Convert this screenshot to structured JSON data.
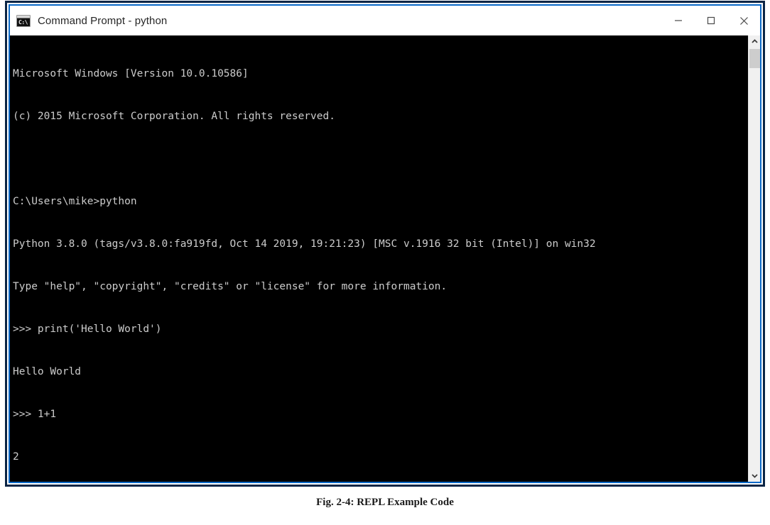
{
  "window": {
    "title": "Command Prompt - python",
    "icon": "console-icon",
    "icon_glyph": "C:\\",
    "border_color": "#0b2545",
    "accent_color": "#0a69c8",
    "controls": [
      {
        "name": "minimize-button",
        "label": "Minimize",
        "glyph": "minimize-icon"
      },
      {
        "name": "maximize-button",
        "label": "Maximize",
        "glyph": "maximize-icon"
      },
      {
        "name": "close-button",
        "label": "Close",
        "glyph": "close-icon"
      }
    ]
  },
  "console": {
    "background_color": "#000000",
    "text_color": "#cccccc",
    "cursor": "block-cursor",
    "lines": [
      "Microsoft Windows [Version 10.0.10586]",
      "(c) 2015 Microsoft Corporation. All rights reserved.",
      "",
      "C:\\Users\\mike>python",
      "Python 3.8.0 (tags/v3.8.0:fa919fd, Oct 14 2019, 19:21:23) [MSC v.1916 32 bit (Intel)] on win32",
      "Type \"help\", \"copyright\", \"credits\" or \"license\" for more information.",
      ">>> print('Hello World')",
      "Hello World",
      ">>> 1+1",
      "2"
    ],
    "prompt": ">>>"
  },
  "scrollbar": {
    "up_arrow": "chevron-up-icon",
    "down_arrow": "chevron-down-icon",
    "thumb": "scrollbar-thumb"
  },
  "caption": {
    "text": "Fig. 2-4: REPL Example Code"
  }
}
